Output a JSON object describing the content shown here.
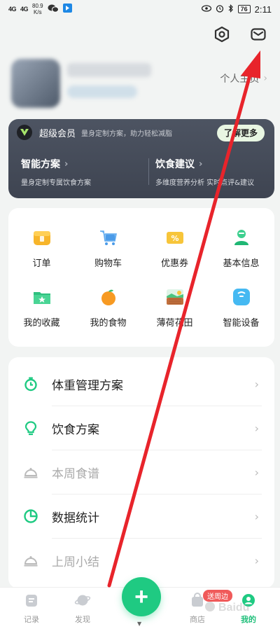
{
  "status_bar": {
    "signal_left_1": "4G",
    "signal_left_2": "4G",
    "net_speed_value": "80.9",
    "net_speed_unit": "K/s",
    "battery": "76",
    "time": "2:11"
  },
  "profile": {
    "homepage_label": "个人主页"
  },
  "vip": {
    "title": "超级会员",
    "subtitle": "量身定制方案，助力轻松减脂",
    "more_button": "了解更多",
    "left_title": "智能方案",
    "left_desc": "量身定制专属饮食方案",
    "right_title": "饮食建议",
    "right_desc": "多维度营养分析 实时点评&建议"
  },
  "grid": {
    "items": [
      {
        "label": "订单"
      },
      {
        "label": "购物车"
      },
      {
        "label": "优惠券"
      },
      {
        "label": "基本信息"
      },
      {
        "label": "我的收藏"
      },
      {
        "label": "我的食物"
      },
      {
        "label": "薄荷花田"
      },
      {
        "label": "智能设备"
      }
    ]
  },
  "list": {
    "items": [
      {
        "label": "体重管理方案"
      },
      {
        "label": "饮食方案"
      },
      {
        "label": "本周食谱"
      },
      {
        "label": "数据统计"
      },
      {
        "label": "上周小结"
      }
    ]
  },
  "bottom_nav": {
    "records": "记录",
    "discover": "发现",
    "shop": "商店",
    "mine": "我的",
    "shop_badge": "送周边",
    "fab_symbol": "+"
  },
  "colors": {
    "accent": "#1fca82",
    "arrow": "#e8242b",
    "vip_bg": "#464c59"
  }
}
